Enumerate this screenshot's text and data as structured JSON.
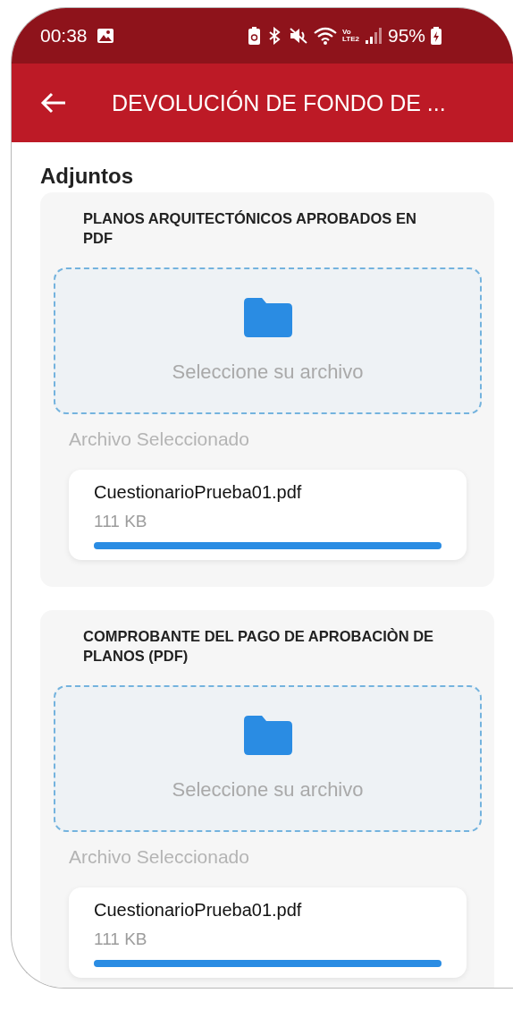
{
  "status_bar": {
    "time": "00:38",
    "network_top": "Vo",
    "network_bottom": "LTE2",
    "battery": "95%"
  },
  "app_bar": {
    "title": "DEVOLUCIÓN DE FONDO DE ..."
  },
  "section_title": "Adjuntos",
  "attachments": [
    {
      "title": "PLANOS ARQUITECTÓNICOS APROBADOS EN PDF",
      "drop_label": "Seleccione su archivo",
      "selected_label": "Archivo Seleccionado",
      "file": {
        "name": "CuestionarioPrueba01.pdf",
        "size": "111 KB",
        "level": 1
      }
    },
    {
      "title": "COMPROBANTE DEL PAGO DE APROBACIÒN DE PLANOS (PDF)",
      "drop_label": "Seleccione su archivo",
      "selected_label": "Archivo Seleccionado",
      "file": {
        "name": "CuestionarioPrueba01.pdf",
        "size": "111 KB",
        "level": 1
      }
    }
  ]
}
